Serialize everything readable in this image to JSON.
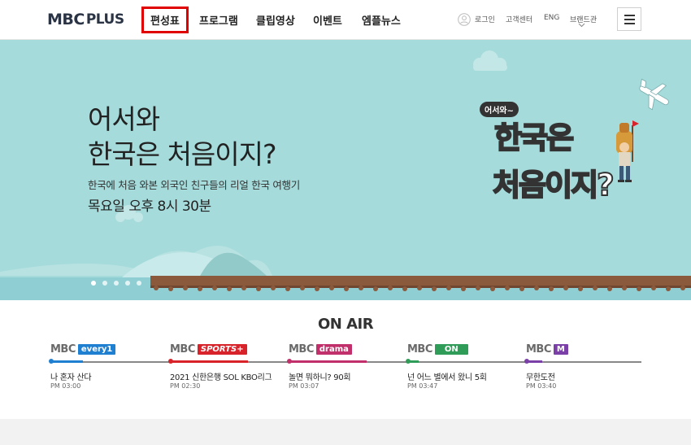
{
  "header": {
    "logo_mbc": "MBC",
    "logo_plus": "PLUS",
    "nav": [
      {
        "label": "편성표",
        "active": true
      },
      {
        "label": "프로그램"
      },
      {
        "label": "클립영상"
      },
      {
        "label": "이벤트"
      },
      {
        "label": "엠플뉴스"
      }
    ],
    "util": {
      "login": "로그인",
      "support": "고객센터",
      "lang": "ENG",
      "brand": "브랜드관"
    }
  },
  "hero": {
    "title": "어서와\n한국은 처음이지?",
    "description": "한국에 처음 와본 외국인 친구들의 리얼 한국 여행기",
    "airtime": "목요일 오후 8시 30분",
    "logo_small": "어서와~",
    "logo_line1": "한국은",
    "logo_line2": "처음이지?",
    "slides": 5,
    "active_slide": 0
  },
  "onair": {
    "title": "ON AIR",
    "channels": [
      {
        "mbc": "MBC",
        "sub": "every1",
        "color": "#1f7fd1",
        "program": "나 혼자 산다",
        "time": "PM 03:00"
      },
      {
        "mbc": "MBC",
        "sub": "SPORTS+",
        "color": "#d8232a",
        "program": "2021 신한은행 SOL KBO리그",
        "time": "PM 02:30"
      },
      {
        "mbc": "MBC",
        "sub": "drama",
        "color": "#c1306a",
        "program": "놀면 뭐하니? 90회",
        "time": "PM 03:07"
      },
      {
        "mbc": "MBC",
        "sub": "ON",
        "color": "#2f9d57",
        "program": "넌 어느 별에서 왔니 5회",
        "time": "PM 03:47"
      },
      {
        "mbc": "MBC",
        "sub": "M",
        "color": "#7b3fa8",
        "program": "무한도전",
        "time": "PM 03:40"
      }
    ]
  }
}
